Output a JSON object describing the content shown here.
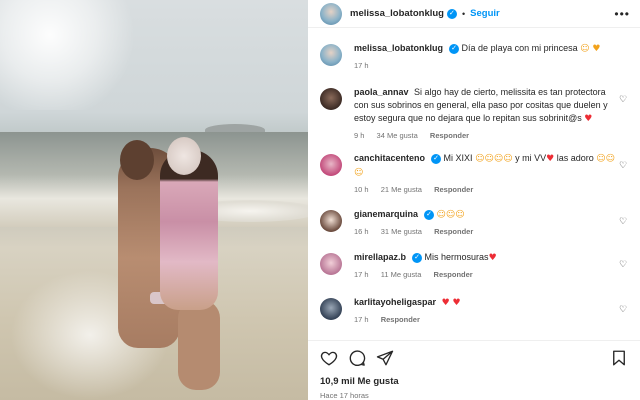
{
  "post": {
    "username": "melissa_lobatonklug",
    "follow_label": "Seguir",
    "separator": "•",
    "more": "•••"
  },
  "caption": {
    "username": "melissa_lobatonklug",
    "text": "Día de playa con mi princesa",
    "emojis": "☺ ♥",
    "time": "17 h"
  },
  "comments": [
    {
      "username": "paola_annav",
      "text": "Si algo hay de cierto, melissita es tan protectora con sus sobrinos en general, ella paso por cositas que duelen y estoy segura que no dejara que lo repitan sus sobrinit@s",
      "emojis": "♥",
      "time": "9 h",
      "likes": "34 Me gusta",
      "reply": "Responder"
    },
    {
      "username": "canchitacenteno",
      "text": "Mi XIXI",
      "emojis_1": "☺☺☺☺",
      "text_2": "y mi VV",
      "emojis_2": "♥",
      "text_3": "las adoro",
      "emojis_3": "☺☺☺",
      "time": "10 h",
      "likes": "21 Me gusta",
      "reply": "Responder"
    },
    {
      "username": "gianemarquina",
      "text": "",
      "emojis": "☺☺☺",
      "time": "16 h",
      "likes": "31 Me gusta",
      "reply": "Responder"
    },
    {
      "username": "mirellapaz.b",
      "text": "Mis hermosuras",
      "emojis": "♥",
      "time": "17 h",
      "likes": "11 Me gusta",
      "reply": "Responder"
    },
    {
      "username": "karlitayoheligaspar",
      "text": "",
      "emojis": "♥ ♥",
      "time": "17 h",
      "likes": "",
      "reply": "Responder"
    }
  ],
  "footer": {
    "likes": "10,9 mil Me gusta",
    "time": "Hace 17 horas"
  },
  "icons": [
    "heart-icon",
    "comment-icon",
    "share-icon",
    "bookmark-icon",
    "verified-icon",
    "more-icon"
  ],
  "colors": {
    "link_blue": "#0095f6",
    "heart_red": "#ed2d35",
    "meta_gray": "#737373"
  }
}
